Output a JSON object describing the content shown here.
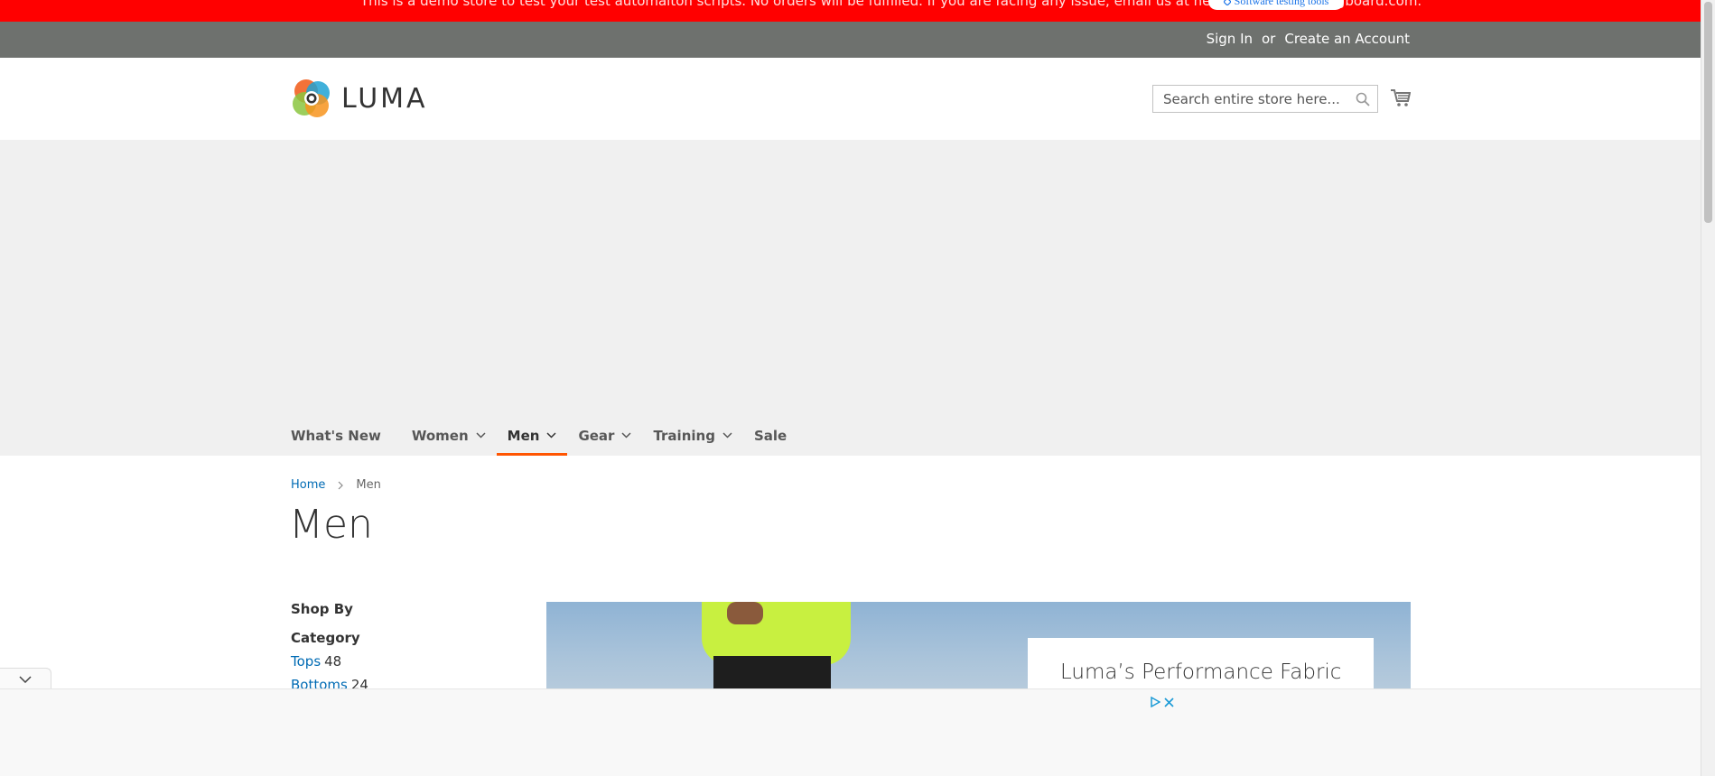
{
  "demo_notice": {
    "text": "This is a demo store to test your test automaiton scripts. No orders will be fulfilled. If you are facing any issue, email us at hello@softwaretestingboard.com.",
    "badge": "Software testing tools"
  },
  "panel": {
    "sign_in": "Sign In",
    "separator": "or",
    "create_account": "Create an Account"
  },
  "header": {
    "logo_text": "LUMA",
    "search_placeholder": "Search entire store here...",
    "cart_icon": "cart-icon",
    "search_icon": "search-icon"
  },
  "nav": {
    "items": [
      {
        "label": "What's New",
        "has_dropdown": false
      },
      {
        "label": "Women",
        "has_dropdown": true
      },
      {
        "label": "Men",
        "has_dropdown": true,
        "active": true
      },
      {
        "label": "Gear",
        "has_dropdown": true
      },
      {
        "label": "Training",
        "has_dropdown": true
      },
      {
        "label": "Sale",
        "has_dropdown": false
      }
    ]
  },
  "breadcrumb": {
    "home": "Home",
    "current": "Men"
  },
  "page": {
    "title": "Men"
  },
  "sidebar": {
    "shop_by": "Shop By",
    "filter_title": "Category",
    "filters": [
      {
        "label": "Tops",
        "count": "48"
      },
      {
        "label": "Bottoms",
        "count": "24"
      }
    ]
  },
  "promo": {
    "title": "Luma’s Performance Fabric"
  },
  "colors": {
    "demo_bar": "#ff0000",
    "panel": "#6e716e",
    "nav_active_underline": "#ff5501",
    "link": "#006bb4"
  }
}
